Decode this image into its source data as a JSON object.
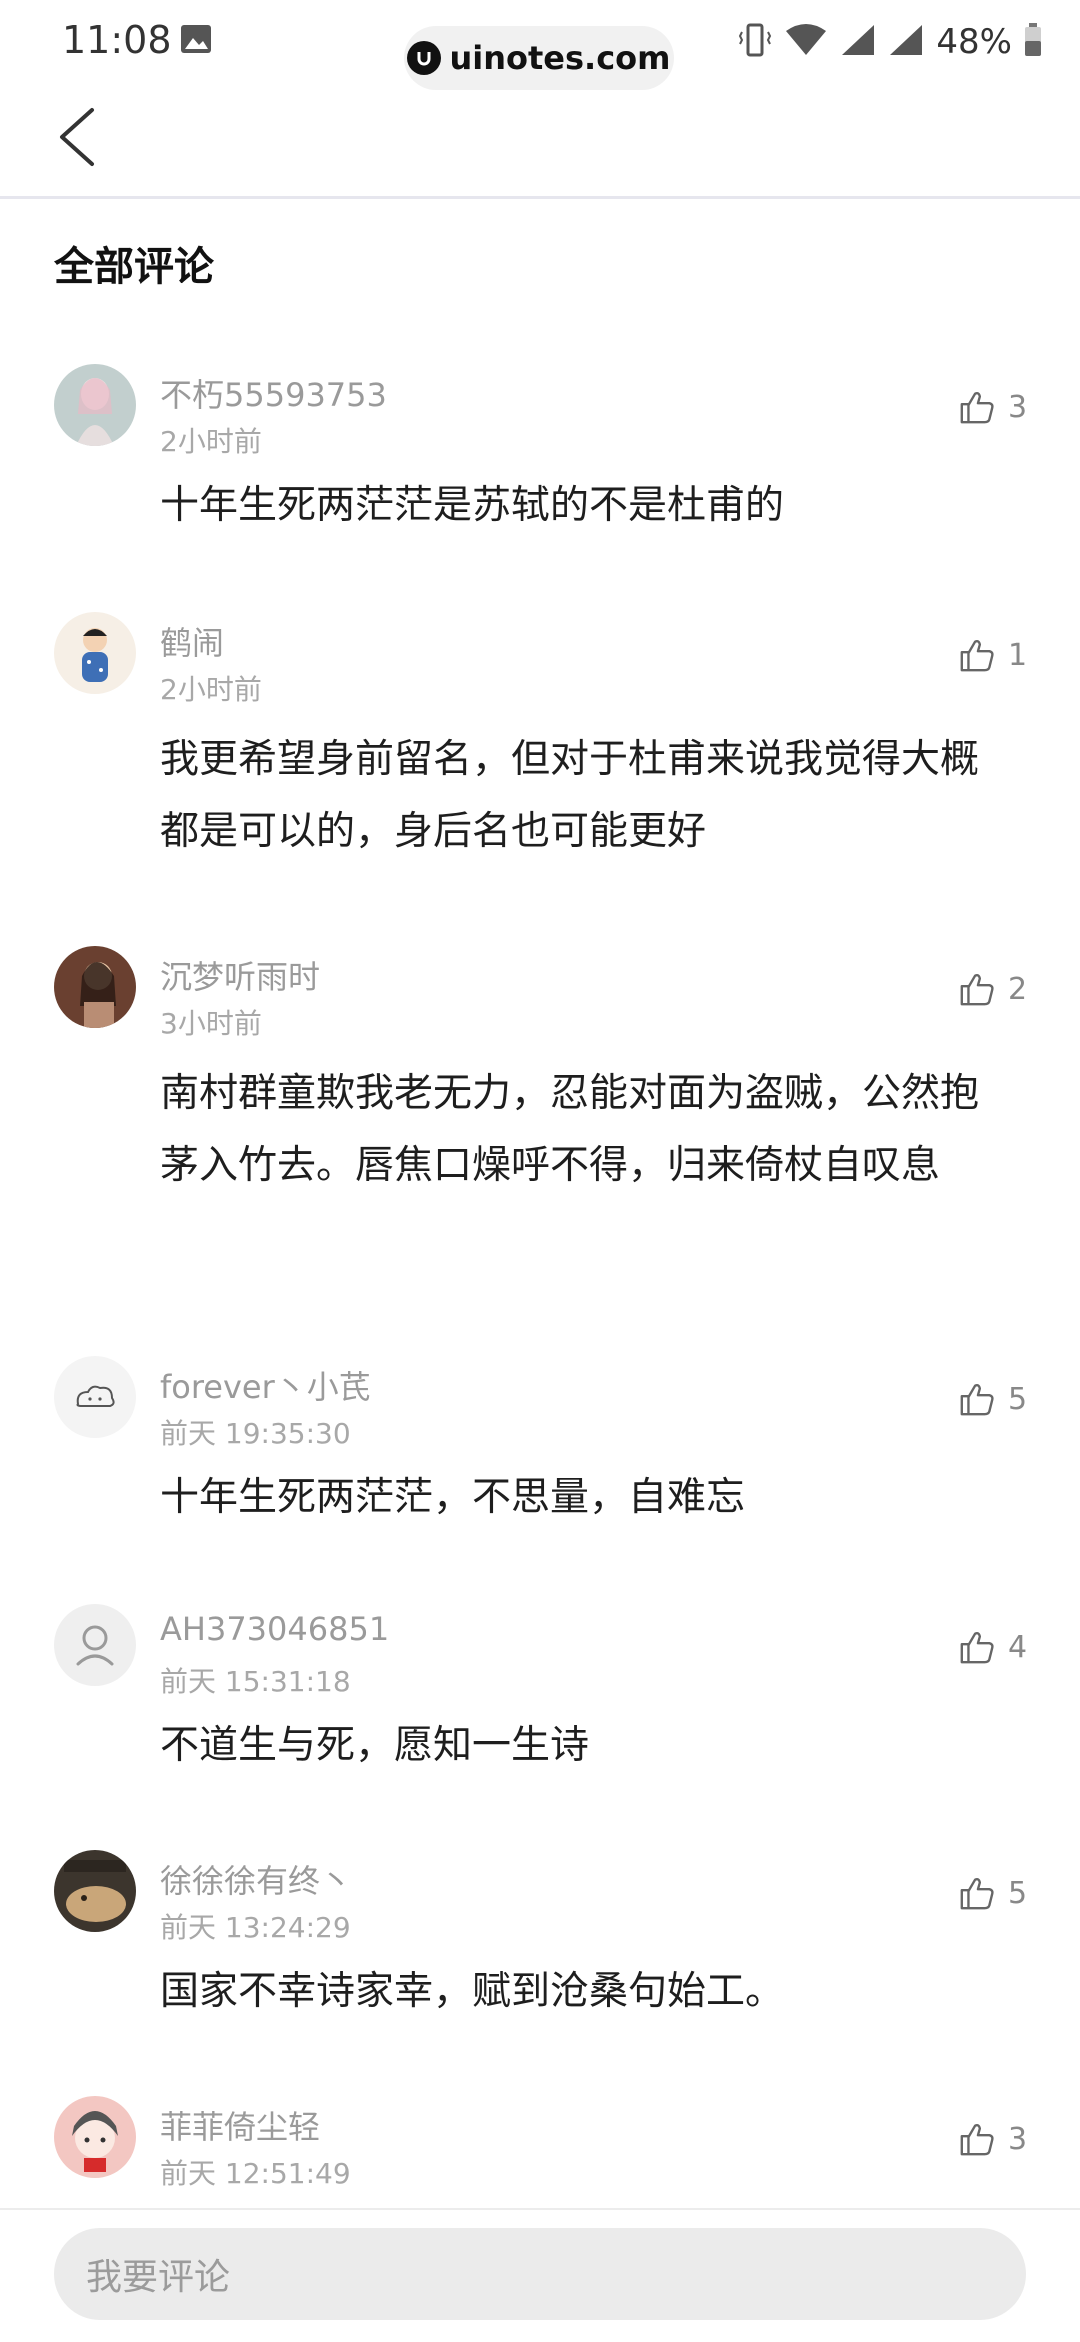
{
  "status_bar": {
    "time": "11:08",
    "url": "uinotes.com",
    "battery": "48%"
  },
  "section_title": "全部评论",
  "comments": [
    {
      "name": "不朽55593753",
      "time": "2小时前",
      "text": "十年生死两茫茫是苏轼的不是杜甫的",
      "likes": "3",
      "avatar_color": "#b9c6c6"
    },
    {
      "name": "鹤闹",
      "time": "2小时前",
      "text": "我更希望身前留名，但对于杜甫来说我觉得大概都是可以的，身后名也可能更好",
      "likes": "1",
      "avatar_color": "#f6efe6"
    },
    {
      "name": "沉梦听雨时",
      "time": "3小时前",
      "text": "南村群童欺我老无力，忍能对面为盗贼，公然抱茅入竹去。唇焦口燥呼不得，归来倚杖自叹息",
      "likes": "2",
      "avatar_color": "#7a5140"
    },
    {
      "name": "forever丶小芪",
      "time": "前天 19:35:30",
      "text": "十年生死两茫茫，不思量，自难忘",
      "likes": "5",
      "avatar_color": "#f4f4f4"
    },
    {
      "name": "AH373046851",
      "time": "前天 15:31:18",
      "text": "不道生与死，愿知一生诗",
      "likes": "4",
      "avatar_color": "#f0f0f0"
    },
    {
      "name": "徐徐徐有终丶",
      "time": "前天 13:24:29",
      "text": "国家不幸诗家幸，赋到沧桑句始工。",
      "likes": "5",
      "avatar_color": "#4a4136"
    },
    {
      "name": "菲菲倚尘轻",
      "time": "前天 12:51:49",
      "text": "",
      "likes": "3",
      "avatar_color": "#f3c7c2"
    }
  ],
  "comment_input": {
    "placeholder": "我要评论"
  }
}
